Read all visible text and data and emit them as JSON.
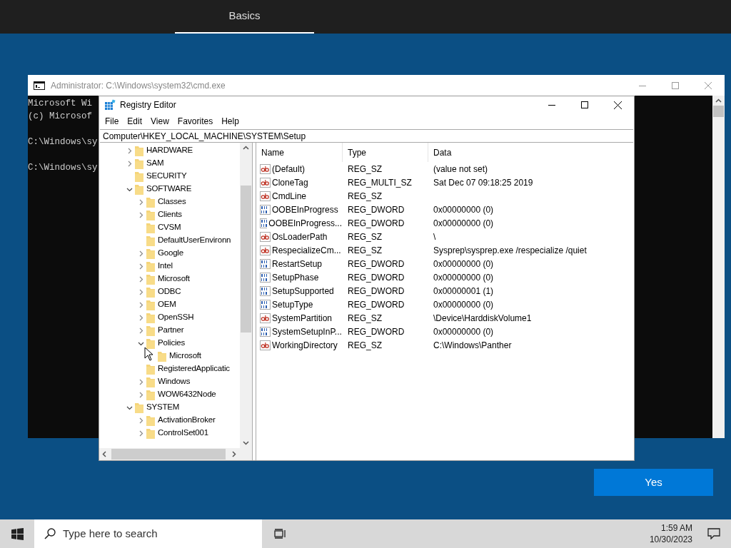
{
  "header": {
    "tabs": [
      {
        "label": "Basics",
        "selected": true
      }
    ]
  },
  "console_window": {
    "title": "Administrator: C:\\Windows\\system32\\cmd.exe",
    "blocks": [
      [
        "Microsoft Wi",
        "(c) Microsof"
      ],
      [
        "C:\\Windows\\sy"
      ],
      [
        "C:\\Windows\\sy"
      ]
    ]
  },
  "registry_editor": {
    "title": "Registry Editor",
    "menu": [
      "File",
      "Edit",
      "View",
      "Favorites",
      "Help"
    ],
    "address": "Computer\\HKEY_LOCAL_MACHINE\\SYSTEM\\Setup",
    "tree": [
      {
        "label": "HARDWARE",
        "expandable": true,
        "expanded": false
      },
      {
        "label": "SAM",
        "expandable": true,
        "expanded": false
      },
      {
        "label": "SECURITY",
        "expandable": false
      },
      {
        "label": "SOFTWARE",
        "expandable": true,
        "expanded": true,
        "children": [
          {
            "label": "Classes",
            "expandable": true,
            "expanded": false
          },
          {
            "label": "Clients",
            "expandable": true,
            "expanded": false
          },
          {
            "label": "CVSM",
            "expandable": false
          },
          {
            "label": "DefaultUserEnvironn",
            "expandable": false
          },
          {
            "label": "Google",
            "expandable": true,
            "expanded": false
          },
          {
            "label": "Intel",
            "expandable": true,
            "expanded": false
          },
          {
            "label": "Microsoft",
            "expandable": true,
            "expanded": false
          },
          {
            "label": "ODBC",
            "expandable": true,
            "expanded": false
          },
          {
            "label": "OEM",
            "expandable": true,
            "expanded": false
          },
          {
            "label": "OpenSSH",
            "expandable": true,
            "expanded": false
          },
          {
            "label": "Partner",
            "expandable": true,
            "expanded": false
          },
          {
            "label": "Policies",
            "expandable": true,
            "expanded": true,
            "children": [
              {
                "label": "Microsoft",
                "expandable": false
              }
            ]
          },
          {
            "label": "RegisteredApplicatic",
            "expandable": false
          },
          {
            "label": "Windows",
            "expandable": true,
            "expanded": false
          },
          {
            "label": "WOW6432Node",
            "expandable": true,
            "expanded": false
          }
        ]
      },
      {
        "label": "SYSTEM",
        "expandable": true,
        "expanded": true,
        "children": [
          {
            "label": "ActivationBroker",
            "expandable": true,
            "expanded": false
          },
          {
            "label": "ControlSet001",
            "expandable": true,
            "expanded": false
          }
        ]
      }
    ],
    "columns": [
      "Name",
      "Type",
      "Data"
    ],
    "values": [
      {
        "kind": "string",
        "name": "(Default)",
        "type": "REG_SZ",
        "data": "(value not set)"
      },
      {
        "kind": "string",
        "name": "CloneTag",
        "type": "REG_MULTI_SZ",
        "data": "Sat Dec 07 09:18:25 2019"
      },
      {
        "kind": "string",
        "name": "CmdLine",
        "type": "REG_SZ"
      },
      {
        "kind": "binary",
        "name": "OOBEInProgress",
        "type": "REG_DWORD",
        "data": "0x00000000 (0)"
      },
      {
        "kind": "binary",
        "name": "OOBEInProgress...",
        "type": "REG_DWORD",
        "data": "0x00000000 (0)"
      },
      {
        "kind": "string",
        "name": "OsLoaderPath",
        "type": "REG_SZ",
        "data": "\\"
      },
      {
        "kind": "string",
        "name": "RespecializeCm...",
        "type": "REG_SZ",
        "data": "Sysprep\\sysprep.exe /respecialize /quiet"
      },
      {
        "kind": "binary",
        "name": "RestartSetup",
        "type": "REG_DWORD",
        "data": "0x00000000 (0)"
      },
      {
        "kind": "binary",
        "name": "SetupPhase",
        "type": "REG_DWORD",
        "data": "0x00000000 (0)"
      },
      {
        "kind": "binary",
        "name": "SetupSupported",
        "type": "REG_DWORD",
        "data": "0x00000001 (1)"
      },
      {
        "kind": "binary",
        "name": "SetupType",
        "type": "REG_DWORD",
        "data": "0x00000000 (0)"
      },
      {
        "kind": "string",
        "name": "SystemPartition",
        "type": "REG_SZ",
        "data": "\\Device\\HarddiskVolume1"
      },
      {
        "kind": "binary",
        "name": "SystemSetupInP...",
        "type": "REG_DWORD",
        "data": "0x00000000 (0)"
      },
      {
        "kind": "string",
        "name": "WorkingDirectory",
        "type": "REG_SZ",
        "data": "C:\\Windows\\Panther"
      }
    ]
  },
  "yes_button": "Yes",
  "taskbar": {
    "search_placeholder": "Type here to search",
    "time": "1:59 AM",
    "date": "10/30/2023"
  }
}
